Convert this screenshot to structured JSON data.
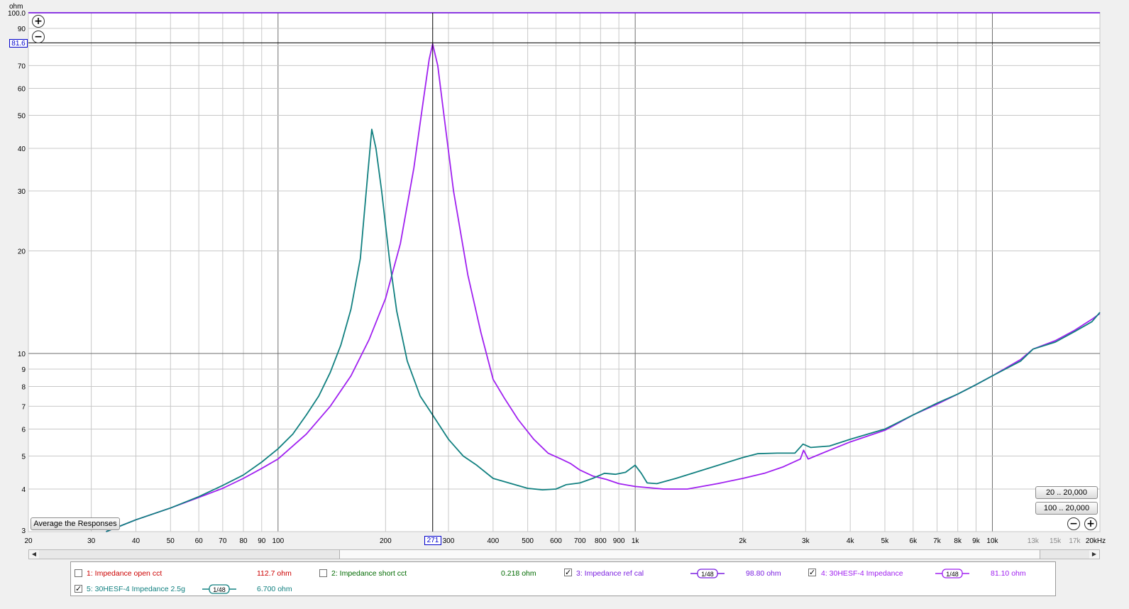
{
  "chart_data": {
    "type": "line",
    "ylabel": "ohm",
    "xscale": "log",
    "yscale": "log",
    "xlim": [
      20,
      20000
    ],
    "ylim": [
      3,
      100
    ],
    "grid": true,
    "x_ticks": [
      "20",
      "30",
      "40",
      "50",
      "60",
      "70",
      "80",
      "90",
      "100",
      "200",
      "300",
      "400",
      "500",
      "600",
      "700",
      "800",
      "900",
      "1k",
      "2k",
      "3k",
      "4k",
      "5k",
      "6k",
      "7k",
      "8k",
      "9k",
      "10k",
      "13k",
      "15k",
      "17k",
      "20kHz"
    ],
    "x_tick_values": [
      20,
      30,
      40,
      50,
      60,
      70,
      80,
      90,
      100,
      200,
      300,
      400,
      500,
      600,
      700,
      800,
      900,
      1000,
      2000,
      3000,
      4000,
      5000,
      6000,
      7000,
      8000,
      9000,
      10000,
      13000,
      15000,
      17000,
      20000
    ],
    "y_ticks": [
      "3",
      "4",
      "5",
      "6",
      "7",
      "8",
      "9",
      "10",
      "20",
      "30",
      "40",
      "50",
      "60",
      "70",
      "90",
      "100.0"
    ],
    "y_tick_values": [
      3,
      4,
      5,
      6,
      7,
      8,
      9,
      10,
      20,
      30,
      40,
      50,
      60,
      70,
      90,
      100
    ],
    "cursor": {
      "x_label": "271",
      "y_label": "81.6",
      "x": 271,
      "y": 81.6
    },
    "series": [
      {
        "name": "3: Impedance ref cal",
        "color": "#7b1fe0",
        "points": [
          [
            20,
            100
          ],
          [
            20000,
            100
          ]
        ]
      },
      {
        "name": "4: 30HESF-4 Impedance",
        "color": "#a020f0",
        "points": [
          [
            33,
            3.0
          ],
          [
            40,
            3.25
          ],
          [
            50,
            3.52
          ],
          [
            60,
            3.78
          ],
          [
            70,
            4.02
          ],
          [
            80,
            4.3
          ],
          [
            90,
            4.6
          ],
          [
            100,
            4.9
          ],
          [
            120,
            5.8
          ],
          [
            140,
            7.0
          ],
          [
            160,
            8.6
          ],
          [
            180,
            11.0
          ],
          [
            200,
            14.5
          ],
          [
            220,
            21
          ],
          [
            240,
            35
          ],
          [
            255,
            55
          ],
          [
            265,
            73
          ],
          [
            271,
            81
          ],
          [
            280,
            70
          ],
          [
            290,
            52
          ],
          [
            310,
            30
          ],
          [
            340,
            17
          ],
          [
            370,
            11.5
          ],
          [
            400,
            8.4
          ],
          [
            430,
            7.4
          ],
          [
            470,
            6.4
          ],
          [
            520,
            5.6
          ],
          [
            570,
            5.1
          ],
          [
            620,
            4.9
          ],
          [
            660,
            4.75
          ],
          [
            700,
            4.55
          ],
          [
            760,
            4.37
          ],
          [
            830,
            4.27
          ],
          [
            900,
            4.15
          ],
          [
            1000,
            4.07
          ],
          [
            1200,
            4.0
          ],
          [
            1400,
            4.0
          ],
          [
            1700,
            4.15
          ],
          [
            2000,
            4.3
          ],
          [
            2300,
            4.45
          ],
          [
            2600,
            4.65
          ],
          [
            2900,
            4.9
          ],
          [
            2960,
            5.2
          ],
          [
            3050,
            4.9
          ],
          [
            3500,
            5.2
          ],
          [
            4000,
            5.5
          ],
          [
            5000,
            5.95
          ],
          [
            6000,
            6.6
          ],
          [
            7000,
            7.1
          ],
          [
            8000,
            7.6
          ],
          [
            9000,
            8.1
          ],
          [
            10000,
            8.6
          ],
          [
            12000,
            9.6
          ],
          [
            13000,
            10.3
          ],
          [
            15000,
            10.9
          ],
          [
            17000,
            11.7
          ],
          [
            19000,
            12.6
          ],
          [
            20000,
            13.1
          ]
        ]
      },
      {
        "name": "5: 30HESF-4 Impedance 2.5g",
        "color": "#118080",
        "points": [
          [
            33,
            3.0
          ],
          [
            40,
            3.25
          ],
          [
            50,
            3.52
          ],
          [
            60,
            3.8
          ],
          [
            70,
            4.1
          ],
          [
            80,
            4.4
          ],
          [
            90,
            4.8
          ],
          [
            100,
            5.25
          ],
          [
            110,
            5.8
          ],
          [
            120,
            6.6
          ],
          [
            130,
            7.5
          ],
          [
            140,
            8.8
          ],
          [
            150,
            10.6
          ],
          [
            160,
            13.5
          ],
          [
            170,
            19
          ],
          [
            178,
            33
          ],
          [
            183,
            45.5
          ],
          [
            188,
            40
          ],
          [
            195,
            30
          ],
          [
            205,
            19
          ],
          [
            215,
            13.3
          ],
          [
            230,
            9.5
          ],
          [
            250,
            7.5
          ],
          [
            271,
            6.6
          ],
          [
            300,
            5.6
          ],
          [
            330,
            5.0
          ],
          [
            360,
            4.7
          ],
          [
            400,
            4.3
          ],
          [
            450,
            4.15
          ],
          [
            500,
            4.02
          ],
          [
            550,
            3.98
          ],
          [
            600,
            4.0
          ],
          [
            640,
            4.12
          ],
          [
            700,
            4.17
          ],
          [
            760,
            4.3
          ],
          [
            820,
            4.45
          ],
          [
            880,
            4.42
          ],
          [
            940,
            4.48
          ],
          [
            1000,
            4.7
          ],
          [
            1040,
            4.45
          ],
          [
            1080,
            4.17
          ],
          [
            1150,
            4.15
          ],
          [
            1300,
            4.3
          ],
          [
            1600,
            4.6
          ],
          [
            2000,
            4.95
          ],
          [
            2200,
            5.08
          ],
          [
            2500,
            5.1
          ],
          [
            2800,
            5.1
          ],
          [
            2950,
            5.42
          ],
          [
            3100,
            5.3
          ],
          [
            3500,
            5.35
          ],
          [
            4000,
            5.6
          ],
          [
            5000,
            6.0
          ],
          [
            6000,
            6.6
          ],
          [
            7000,
            7.15
          ],
          [
            8000,
            7.6
          ],
          [
            9000,
            8.1
          ],
          [
            10000,
            8.6
          ],
          [
            12000,
            9.5
          ],
          [
            13000,
            10.3
          ],
          [
            15000,
            10.8
          ],
          [
            17000,
            11.6
          ],
          [
            19000,
            12.4
          ],
          [
            20000,
            13.2
          ]
        ]
      }
    ]
  },
  "legend": [
    {
      "label": "1: Impedance open cct",
      "value": "112.7 ohm",
      "checked": false,
      "color": "#cc0000",
      "smoothing": ""
    },
    {
      "label": "2: Impedance short cct",
      "value": "0.218 ohm",
      "checked": false,
      "color": "#006a00",
      "smoothing": ""
    },
    {
      "label": "3: Impedance ref cal",
      "value": "98.80 ohm",
      "checked": true,
      "color": "#7b1fe0",
      "smoothing": "1/48"
    },
    {
      "label": "4: 30HESF-4 Impedance",
      "value": "81.10 ohm",
      "checked": true,
      "color": "#a020f0",
      "smoothing": "1/48"
    },
    {
      "label": "5: 30HESF-4 Impedance 2.5g",
      "value": "6.700 ohm",
      "checked": true,
      "color": "#118080",
      "smoothing": "1/48"
    }
  ],
  "buttons": {
    "average": "Average the Responses",
    "range1": "20 .. 20,000",
    "range2": "100 .. 20,000"
  },
  "icons": {
    "zoom_in": "plus-circle-icon",
    "zoom_out": "minus-circle-icon",
    "scroll_left": "arrow-left-icon",
    "scroll_right": "arrow-right-icon",
    "check": "checkmark-icon"
  }
}
